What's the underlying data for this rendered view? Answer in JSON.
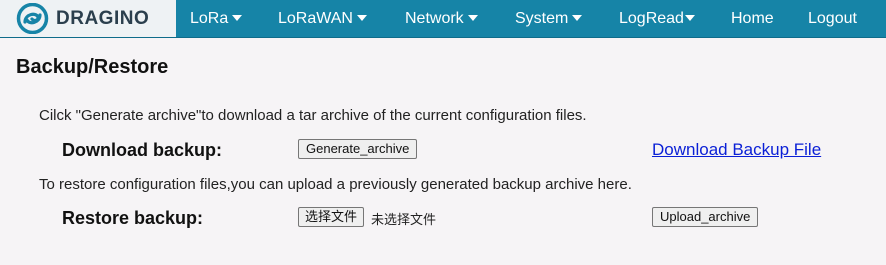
{
  "brand": {
    "name": "DRAGINO",
    "logo_icon": "dragino-swirl-logo-icon",
    "logo_color": "#1684a7"
  },
  "colors": {
    "navbar": "#1684a7",
    "brand_bg": "#eef2f4",
    "page_bg": "#f6f4f6",
    "link": "#0a1fd6"
  },
  "nav": {
    "items": [
      {
        "label": "LoRa",
        "dropdown": true
      },
      {
        "label": "LoRaWAN",
        "dropdown": true
      },
      {
        "label": "Network",
        "dropdown": true
      },
      {
        "label": "System",
        "dropdown": true
      },
      {
        "label": "LogRead",
        "dropdown": true
      },
      {
        "label": "Home",
        "dropdown": false
      },
      {
        "label": "Logout",
        "dropdown": false
      }
    ]
  },
  "page": {
    "title": "Backup/Restore",
    "download_hint": "Cilck \"Generate archive\"to download a tar archive of the current configuration files.",
    "download_label": "Download backup:",
    "generate_button": "Generate_archive",
    "download_link": "Download Backup File",
    "restore_hint": "To restore configuration files,you can upload a previously generated backup archive here.",
    "restore_label": "Restore backup:",
    "choose_file_button": "选择文件",
    "no_file_text": "未选择文件",
    "upload_button": "Upload_archive"
  }
}
